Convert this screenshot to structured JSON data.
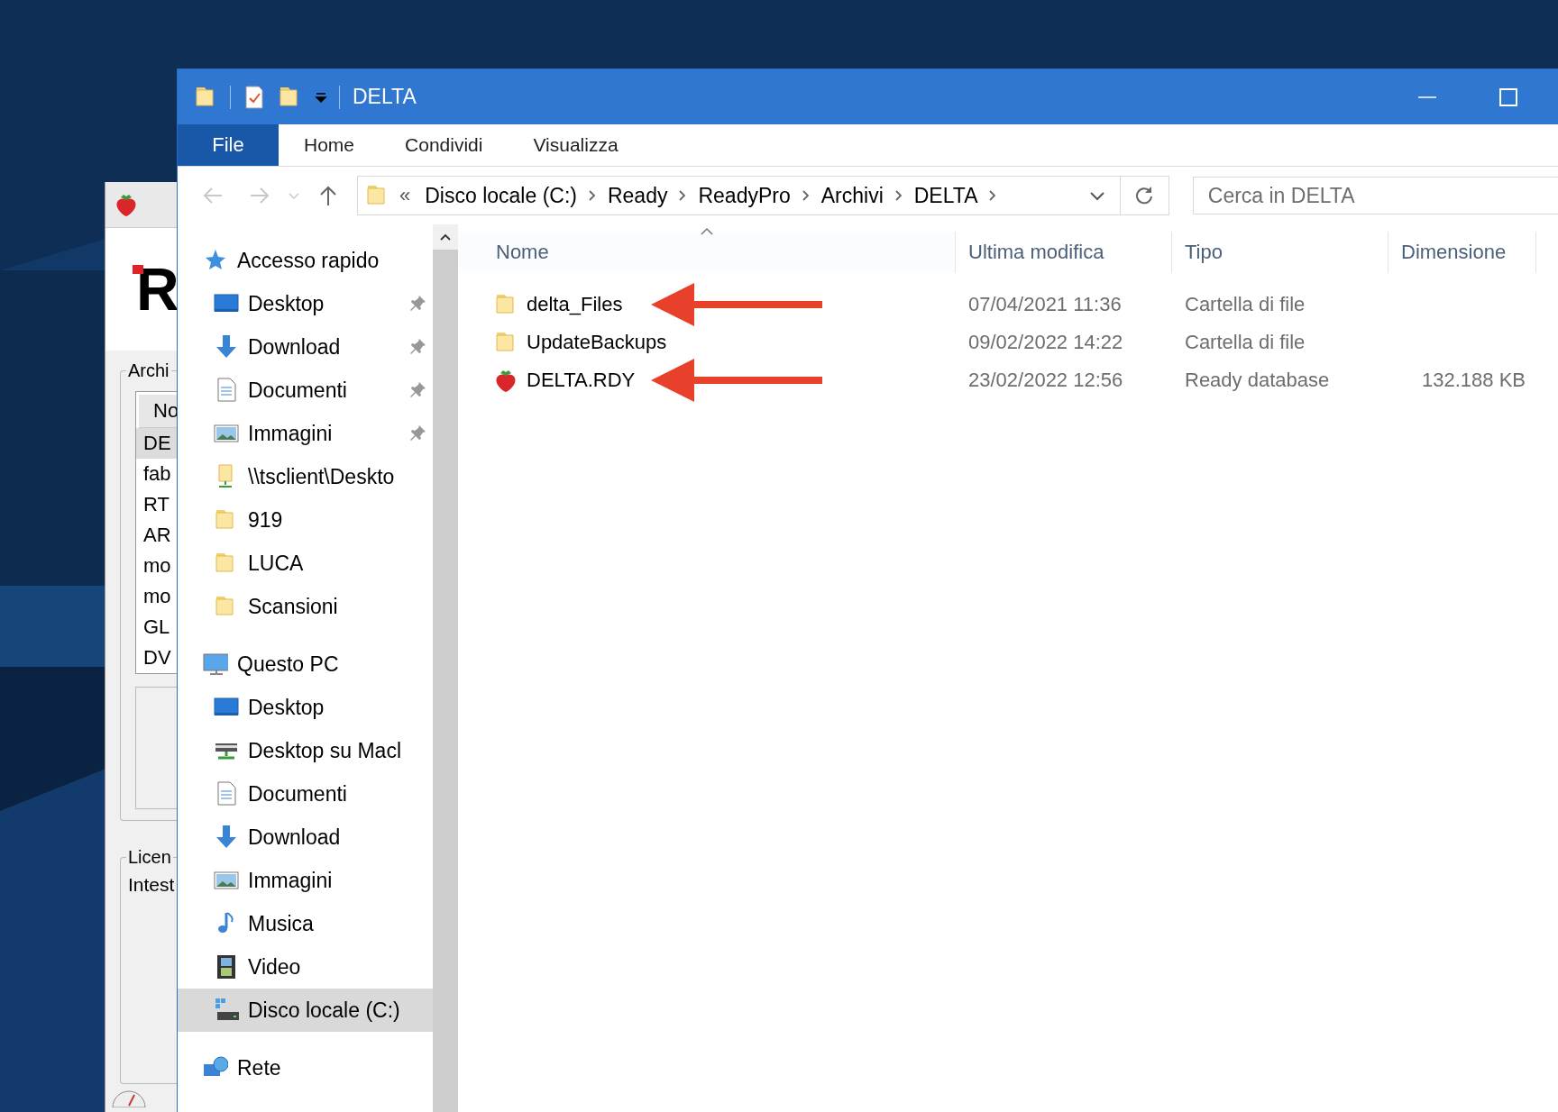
{
  "background_window": {
    "logo": "R",
    "group_label": "Archi",
    "list_header": "No",
    "list_rows": [
      {
        "text": "DE",
        "selected": true
      },
      {
        "text": "fab",
        "selected": false
      },
      {
        "text": "RT",
        "selected": false
      },
      {
        "text": "AR",
        "selected": false
      },
      {
        "text": "mo",
        "selected": false
      },
      {
        "text": "mo",
        "selected": false
      },
      {
        "text": "GL",
        "selected": false
      },
      {
        "text": "DV",
        "selected": false
      }
    ],
    "group2_label": "Licen",
    "field_label": "Intest"
  },
  "window": {
    "title": "DELTA"
  },
  "ribbon": {
    "file_button": "File",
    "tabs": [
      {
        "label": "Home",
        "selected": false
      },
      {
        "label": "Condividi",
        "selected": false
      },
      {
        "label": "Visualizza",
        "selected": false
      }
    ]
  },
  "address_bar": {
    "overflow": "«",
    "crumbs": [
      "Disco locale (C:)",
      "Ready",
      "ReadyPro",
      "Archivi",
      "DELTA"
    ]
  },
  "search": {
    "placeholder": "Cerca in DELTA"
  },
  "sidebar": {
    "items": [
      {
        "label": "Accesso rapido",
        "kind": "star",
        "selected": false,
        "children": [
          {
            "label": "Desktop",
            "kind": "desktop",
            "pinned": true,
            "selected": false
          },
          {
            "label": "Download",
            "kind": "download",
            "pinned": true,
            "selected": false
          },
          {
            "label": "Documenti",
            "kind": "document",
            "pinned": true,
            "selected": false
          },
          {
            "label": "Immagini",
            "kind": "pictures",
            "pinned": true,
            "selected": false
          },
          {
            "label": "\\\\tsclient\\Deskto",
            "kind": "share",
            "pinned": false,
            "selected": false
          },
          {
            "label": "919",
            "kind": "folder",
            "pinned": false,
            "selected": false
          },
          {
            "label": "LUCA",
            "kind": "folder",
            "pinned": false,
            "selected": false
          },
          {
            "label": "Scansioni",
            "kind": "folder",
            "pinned": false,
            "selected": false
          }
        ]
      },
      {
        "label": "Questo PC",
        "kind": "pc",
        "selected": false,
        "children": [
          {
            "label": "Desktop",
            "kind": "desktop",
            "pinned": false,
            "selected": false
          },
          {
            "label": "Desktop su Macl",
            "kind": "netdrive",
            "pinned": false,
            "selected": false
          },
          {
            "label": "Documenti",
            "kind": "document",
            "pinned": false,
            "selected": false
          },
          {
            "label": "Download",
            "kind": "download",
            "pinned": false,
            "selected": false
          },
          {
            "label": "Immagini",
            "kind": "pictures",
            "pinned": false,
            "selected": false
          },
          {
            "label": "Musica",
            "kind": "music",
            "pinned": false,
            "selected": false
          },
          {
            "label": "Video",
            "kind": "video",
            "pinned": false,
            "selected": false
          },
          {
            "label": "Disco locale (C:)",
            "kind": "drive",
            "pinned": false,
            "selected": true
          }
        ]
      },
      {
        "label": "Rete",
        "kind": "network",
        "selected": false
      }
    ]
  },
  "table": {
    "columns": [
      {
        "label": "Nome",
        "sorted": true
      },
      {
        "label": "Ultima modifica",
        "sorted": false
      },
      {
        "label": "Tipo",
        "sorted": false
      },
      {
        "label": "Dimensione",
        "sorted": false
      }
    ],
    "rows": [
      {
        "name": "delta_Files",
        "kind": "folder",
        "modified": "07/04/2021 11:36",
        "type": "Cartella di file",
        "highlighted": true
      },
      {
        "name": "UpdateBackups",
        "kind": "folder",
        "modified": "09/02/2022 14:22",
        "type": "Cartella di file",
        "highlighted": false
      },
      {
        "name": "DELTA.RDY",
        "kind": "strawberry",
        "modified": "23/02/2022 12:56",
        "type": "Ready database",
        "size": "132.188 KB",
        "highlighted": true
      }
    ]
  }
}
